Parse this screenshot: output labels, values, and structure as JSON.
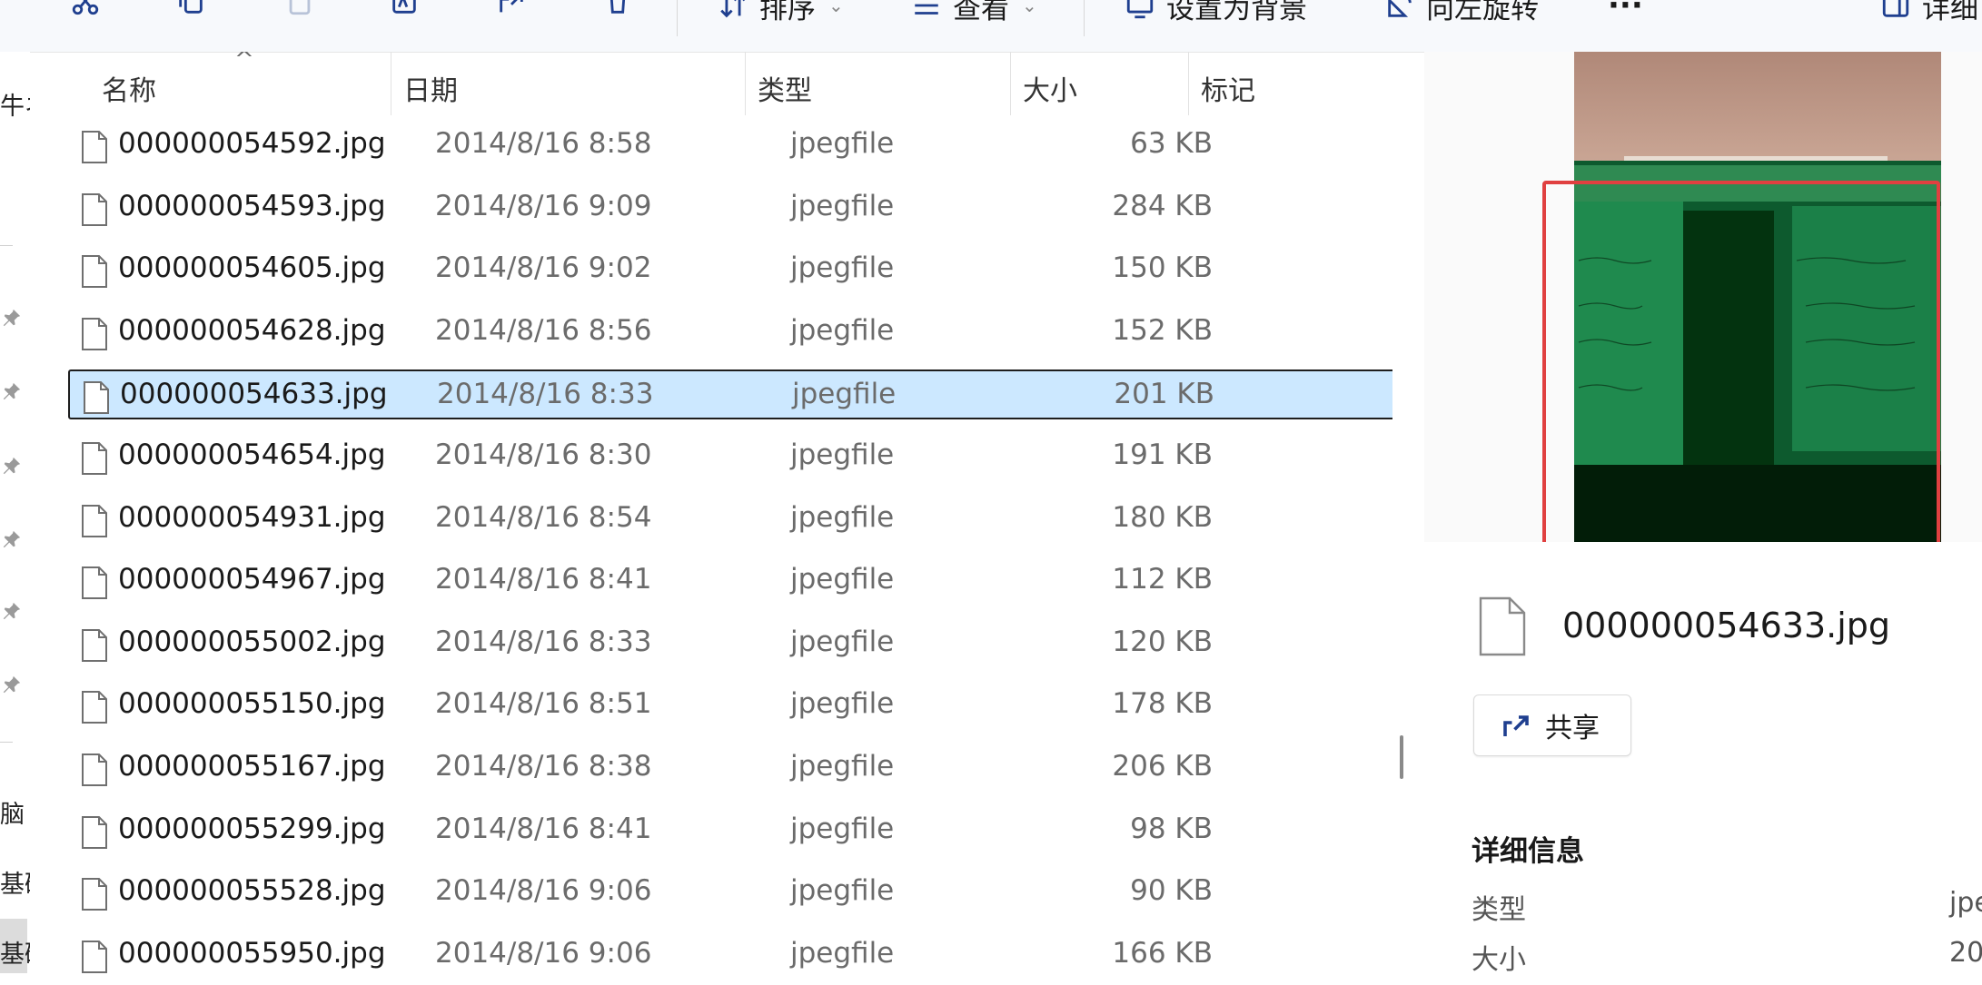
{
  "toolbar": {
    "sort_label": "排序",
    "view_label": "查看",
    "set_background_label": "设置为背景",
    "rotate_left_label": "向左旋转",
    "more_label": "···",
    "details_label": "详细"
  },
  "nav_strip": {
    "fragments": [
      "牛ネ",
      "脑",
      "基础",
      "基础"
    ]
  },
  "columns": {
    "name": "名称",
    "date": "日期",
    "type": "类型",
    "size": "大小",
    "tags": "标记"
  },
  "files": [
    {
      "name": "000000054592.jpg",
      "date": "2014/8/16 8:58",
      "type": "jpegfile",
      "size": "63 KB"
    },
    {
      "name": "000000054593.jpg",
      "date": "2014/8/16 9:09",
      "type": "jpegfile",
      "size": "284 KB"
    },
    {
      "name": "000000054605.jpg",
      "date": "2014/8/16 9:02",
      "type": "jpegfile",
      "size": "150 KB"
    },
    {
      "name": "000000054628.jpg",
      "date": "2014/8/16 8:56",
      "type": "jpegfile",
      "size": "152 KB"
    },
    {
      "name": "000000054633.jpg",
      "date": "2014/8/16 8:33",
      "type": "jpegfile",
      "size": "201 KB",
      "selected": true
    },
    {
      "name": "000000054654.jpg",
      "date": "2014/8/16 8:30",
      "type": "jpegfile",
      "size": "191 KB"
    },
    {
      "name": "000000054931.jpg",
      "date": "2014/8/16 8:54",
      "type": "jpegfile",
      "size": "180 KB"
    },
    {
      "name": "000000054967.jpg",
      "date": "2014/8/16 8:41",
      "type": "jpegfile",
      "size": "112 KB"
    },
    {
      "name": "000000055002.jpg",
      "date": "2014/8/16 8:33",
      "type": "jpegfile",
      "size": "120 KB"
    },
    {
      "name": "000000055150.jpg",
      "date": "2014/8/16 8:51",
      "type": "jpegfile",
      "size": "178 KB"
    },
    {
      "name": "000000055167.jpg",
      "date": "2014/8/16 8:38",
      "type": "jpegfile",
      "size": "206 KB"
    },
    {
      "name": "000000055299.jpg",
      "date": "2014/8/16 8:41",
      "type": "jpegfile",
      "size": "98 KB"
    },
    {
      "name": "000000055528.jpg",
      "date": "2014/8/16 9:06",
      "type": "jpegfile",
      "size": "90 KB"
    },
    {
      "name": "000000055950.jpg",
      "date": "2014/8/16 9:06",
      "type": "jpegfile",
      "size": "166 KB"
    }
  ],
  "preview": {
    "filename": "000000054633.jpg",
    "share_label": "共享",
    "details_title": "详细信息",
    "props": [
      {
        "label": "类型",
        "value": "jpe"
      },
      {
        "label": "大小",
        "value": "20"
      }
    ]
  },
  "colors": {
    "selection_bg": "#cce8ff",
    "accent_icon": "#1f3f8f",
    "annotation_box": "#e04040"
  }
}
